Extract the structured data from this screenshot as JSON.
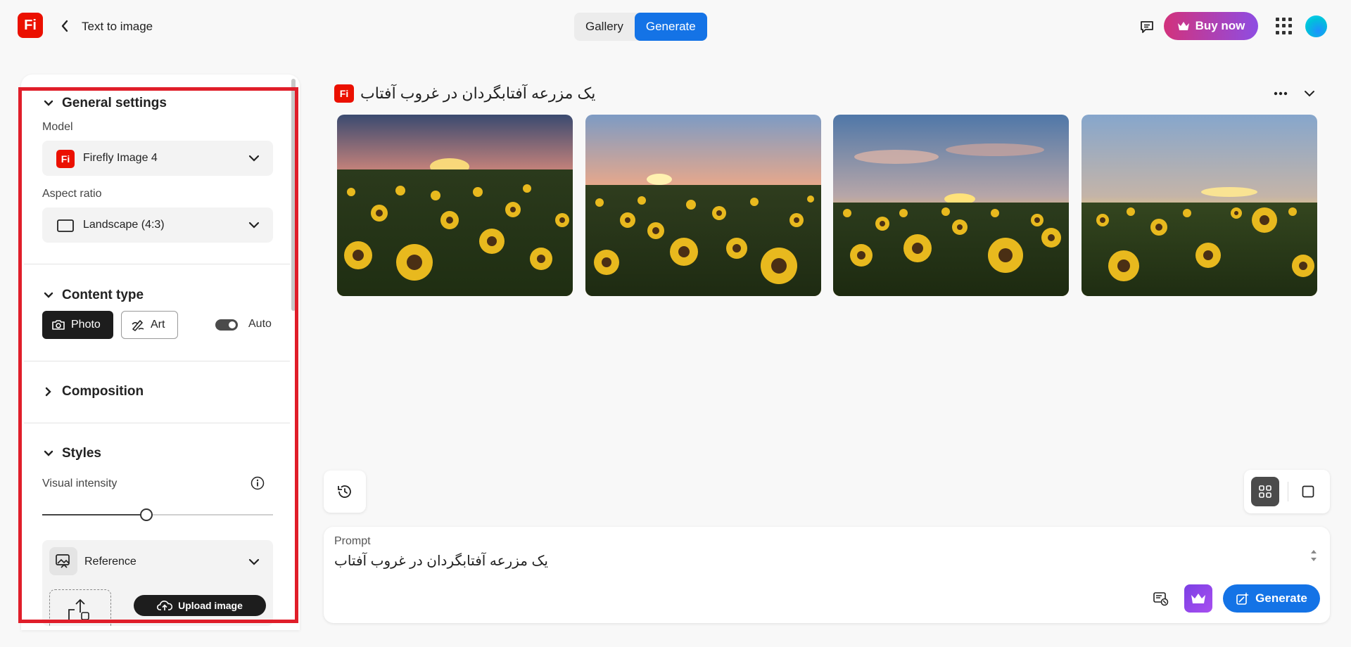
{
  "app": {
    "logo_text": "Fi",
    "page_title": "Text to image"
  },
  "header": {
    "tabs": [
      {
        "label": "Gallery",
        "active": false
      },
      {
        "label": "Generate",
        "active": true
      }
    ],
    "buy_label": "Buy now"
  },
  "settings": {
    "general": {
      "title": "General settings",
      "model_label": "Model",
      "model_value": "Firefly Image 4",
      "aspect_label": "Aspect ratio",
      "aspect_value": "Landscape (4:3)"
    },
    "content_type": {
      "title": "Content type",
      "photo_label": "Photo",
      "art_label": "Art",
      "selected": "Photo",
      "auto_label": "Auto",
      "auto_on": true
    },
    "composition": {
      "title": "Composition"
    },
    "styles": {
      "title": "Styles",
      "visual_intensity_label": "Visual intensity",
      "visual_intensity_value": 0.45,
      "reference_label": "Reference",
      "upload_label": "Upload image"
    }
  },
  "result": {
    "title": "یک مزرعه آفتابگردان در غروب آفتاب",
    "image_count": 4
  },
  "prompt": {
    "label": "Prompt",
    "value": "یک مزرعه آفتابگردان در غروب آفتاب",
    "generate_label": "Generate"
  },
  "colors": {
    "accent": "#1473e6",
    "brand": "#eb1000",
    "highlight_outline": "#e01e2a"
  },
  "icons": [
    "back-chevron-icon",
    "chat-icon",
    "crown-icon",
    "apps-grid-icon",
    "camera-icon",
    "brush-icon",
    "info-icon",
    "reference-image-icon",
    "upload-cloud-icon",
    "history-icon",
    "grid-view-icon",
    "single-view-icon",
    "more-icon",
    "chevron-down-icon",
    "image-settings-icon",
    "generate-sparkle-icon"
  ]
}
